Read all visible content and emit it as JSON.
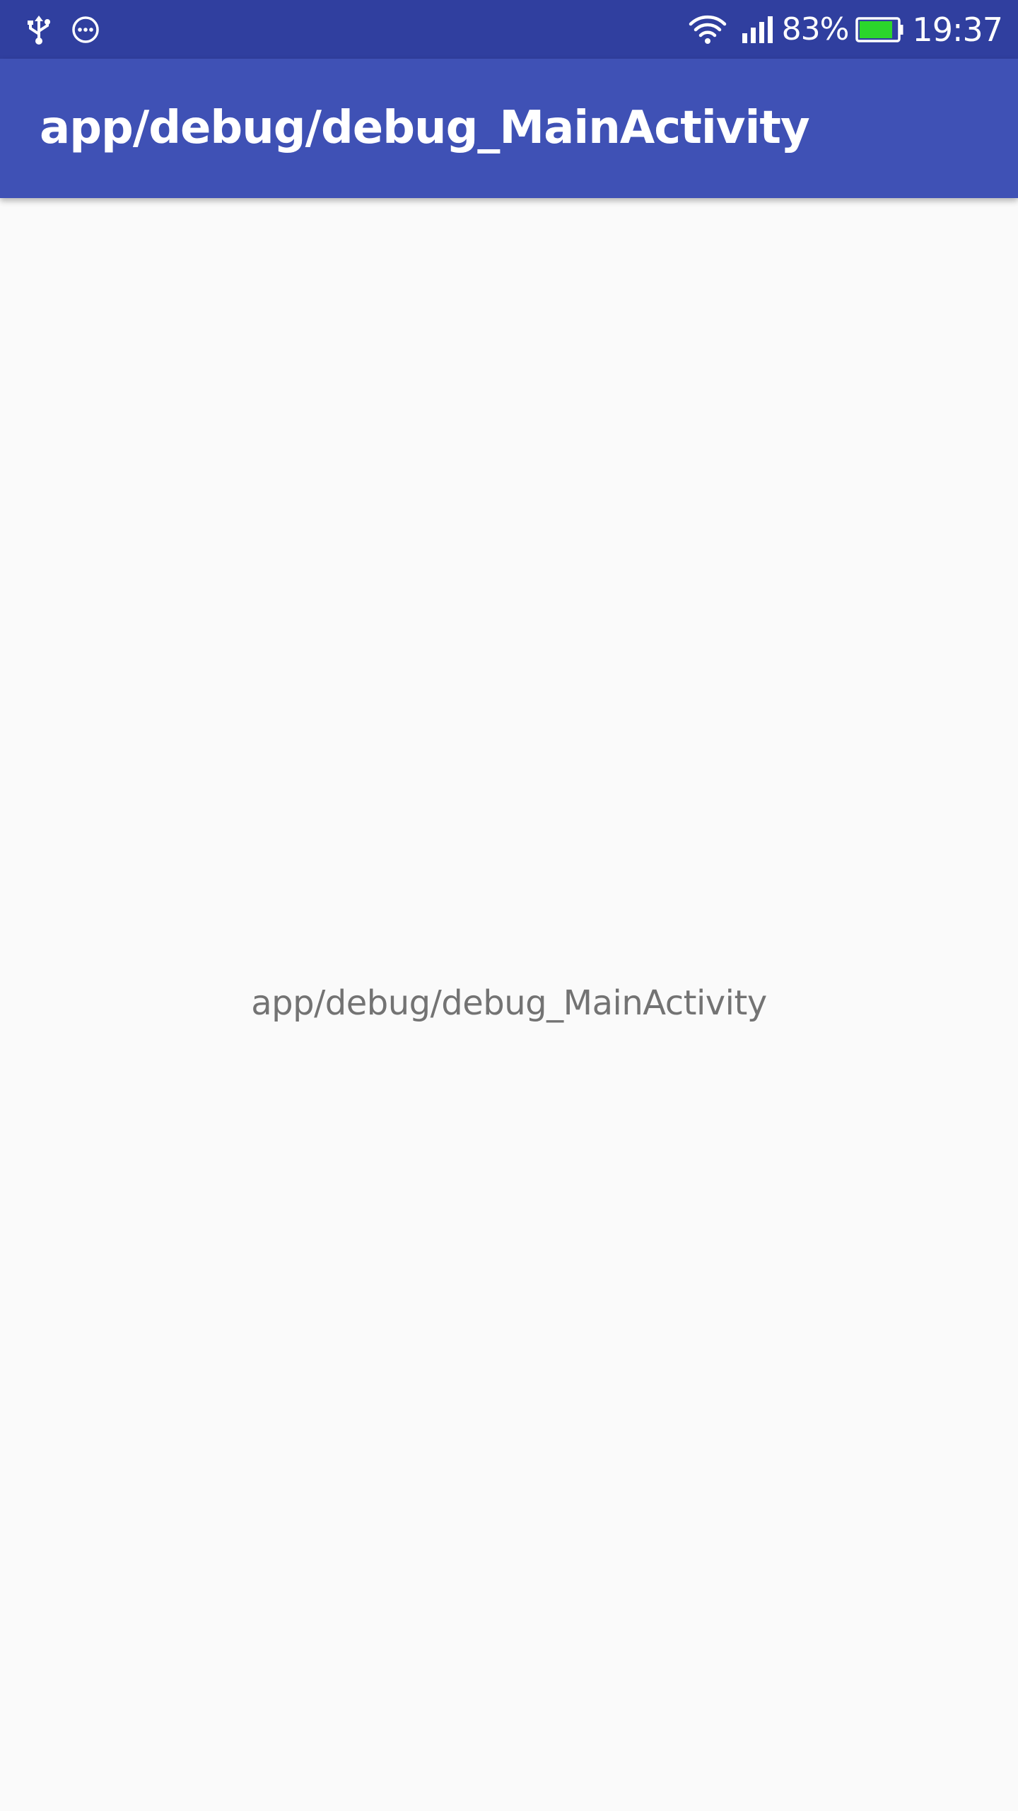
{
  "status_bar": {
    "left_icons": [
      "usb-icon",
      "more-dots-icon"
    ],
    "right_icons": [
      "wifi-icon",
      "signal-icon",
      "battery-icon"
    ],
    "battery_percent": "83%",
    "time": "19:37",
    "colors": {
      "background": "#303f9f",
      "battery_fill": "#2bd62b"
    }
  },
  "app_bar": {
    "title": "app/debug/debug_MainActivity",
    "color": "#3f51b5"
  },
  "main": {
    "text": "app/debug/debug_MainActivity",
    "background": "#fafafa"
  }
}
